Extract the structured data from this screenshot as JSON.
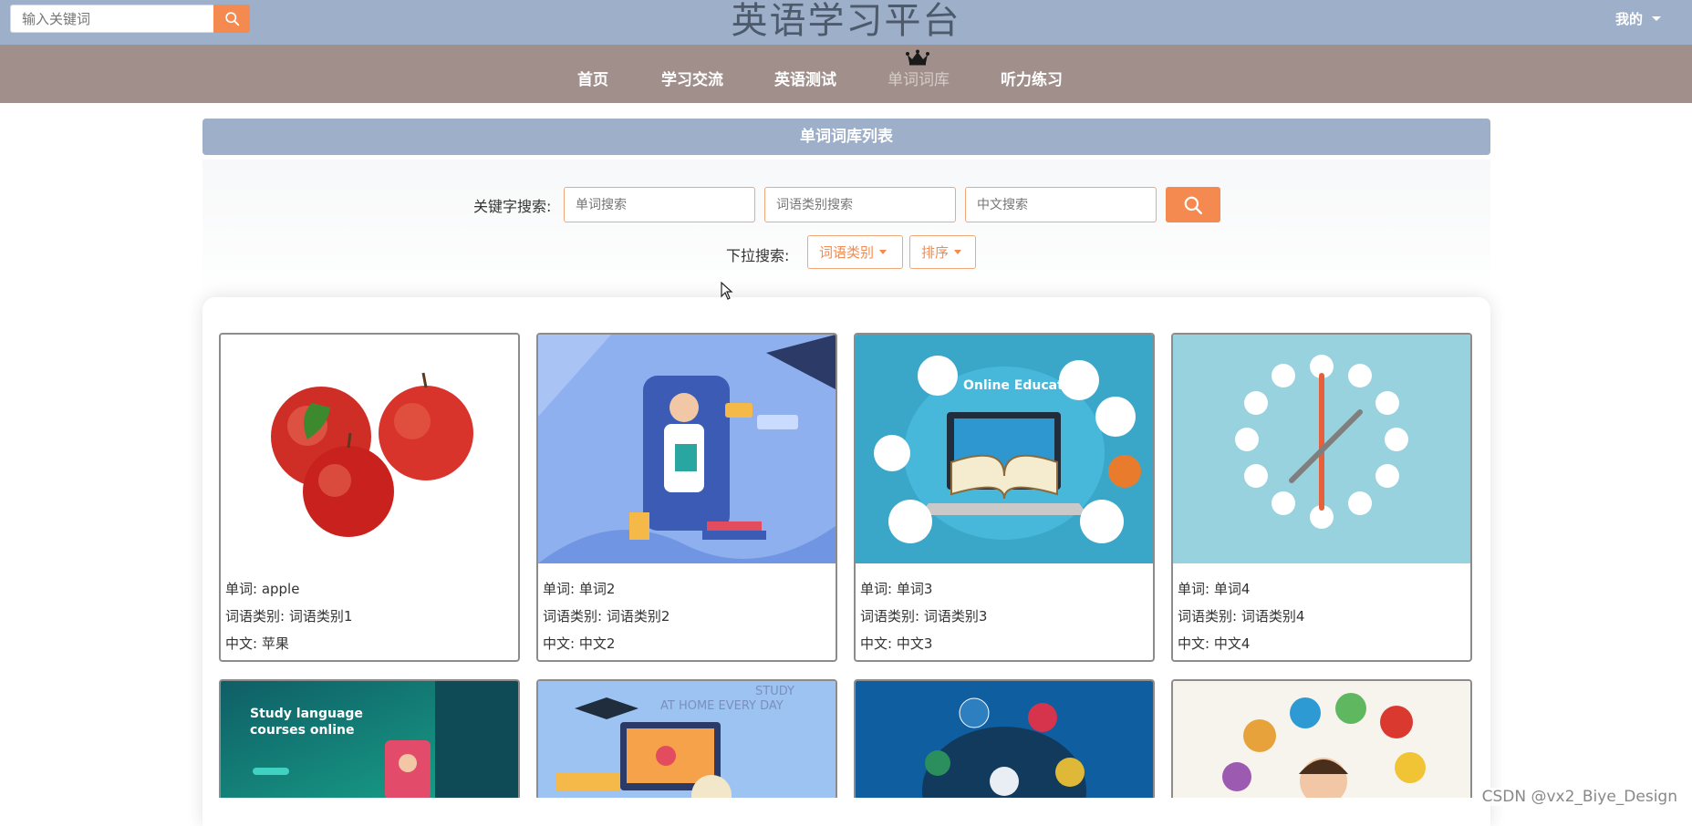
{
  "header": {
    "search_placeholder": "输入关键词",
    "site_title": "英语学习平台",
    "mine_label": "我的"
  },
  "nav": {
    "items": [
      {
        "label": "首页",
        "active": false
      },
      {
        "label": "学习交流",
        "active": false
      },
      {
        "label": "英语测试",
        "active": false
      },
      {
        "label": "单词词库",
        "active": true
      },
      {
        "label": "听力练习",
        "active": false
      }
    ]
  },
  "list": {
    "title": "单词词库列表"
  },
  "search": {
    "keyword_label": "关键字搜索:",
    "word_placeholder": "单词搜索",
    "category_placeholder": "词语类别搜索",
    "chinese_placeholder": "中文搜索",
    "dropdown_label": "下拉搜索:",
    "category_dropdown": "词语类别",
    "sort_dropdown": "排序"
  },
  "cards": [
    {
      "word": "单词: apple",
      "category": "词语类别: 词语类别1",
      "chinese": "中文: 苹果"
    },
    {
      "word": "单词: 单词2",
      "category": "词语类别: 词语类别2",
      "chinese": "中文: 中文2"
    },
    {
      "word": "单词: 单词3",
      "category": "词语类别: 词语类别3",
      "chinese": "中文: 中文3",
      "image_text": "Online Education"
    },
    {
      "word": "单词: 单词4",
      "category": "词语类别: 词语类别4",
      "chinese": "中文: 中文4"
    }
  ],
  "partial_cards": [
    {
      "image_text_1": "Study language",
      "image_text_2": "courses online"
    },
    {
      "image_text_1": "STUDY",
      "image_text_2": "AT HOME EVERY DAY"
    },
    {},
    {}
  ],
  "watermark": "CSDN @vx2_Biye_Design",
  "colors": {
    "header_bg": "#9eafc9",
    "nav_bg": "#a08f8a",
    "accent": "#f48a4f"
  }
}
